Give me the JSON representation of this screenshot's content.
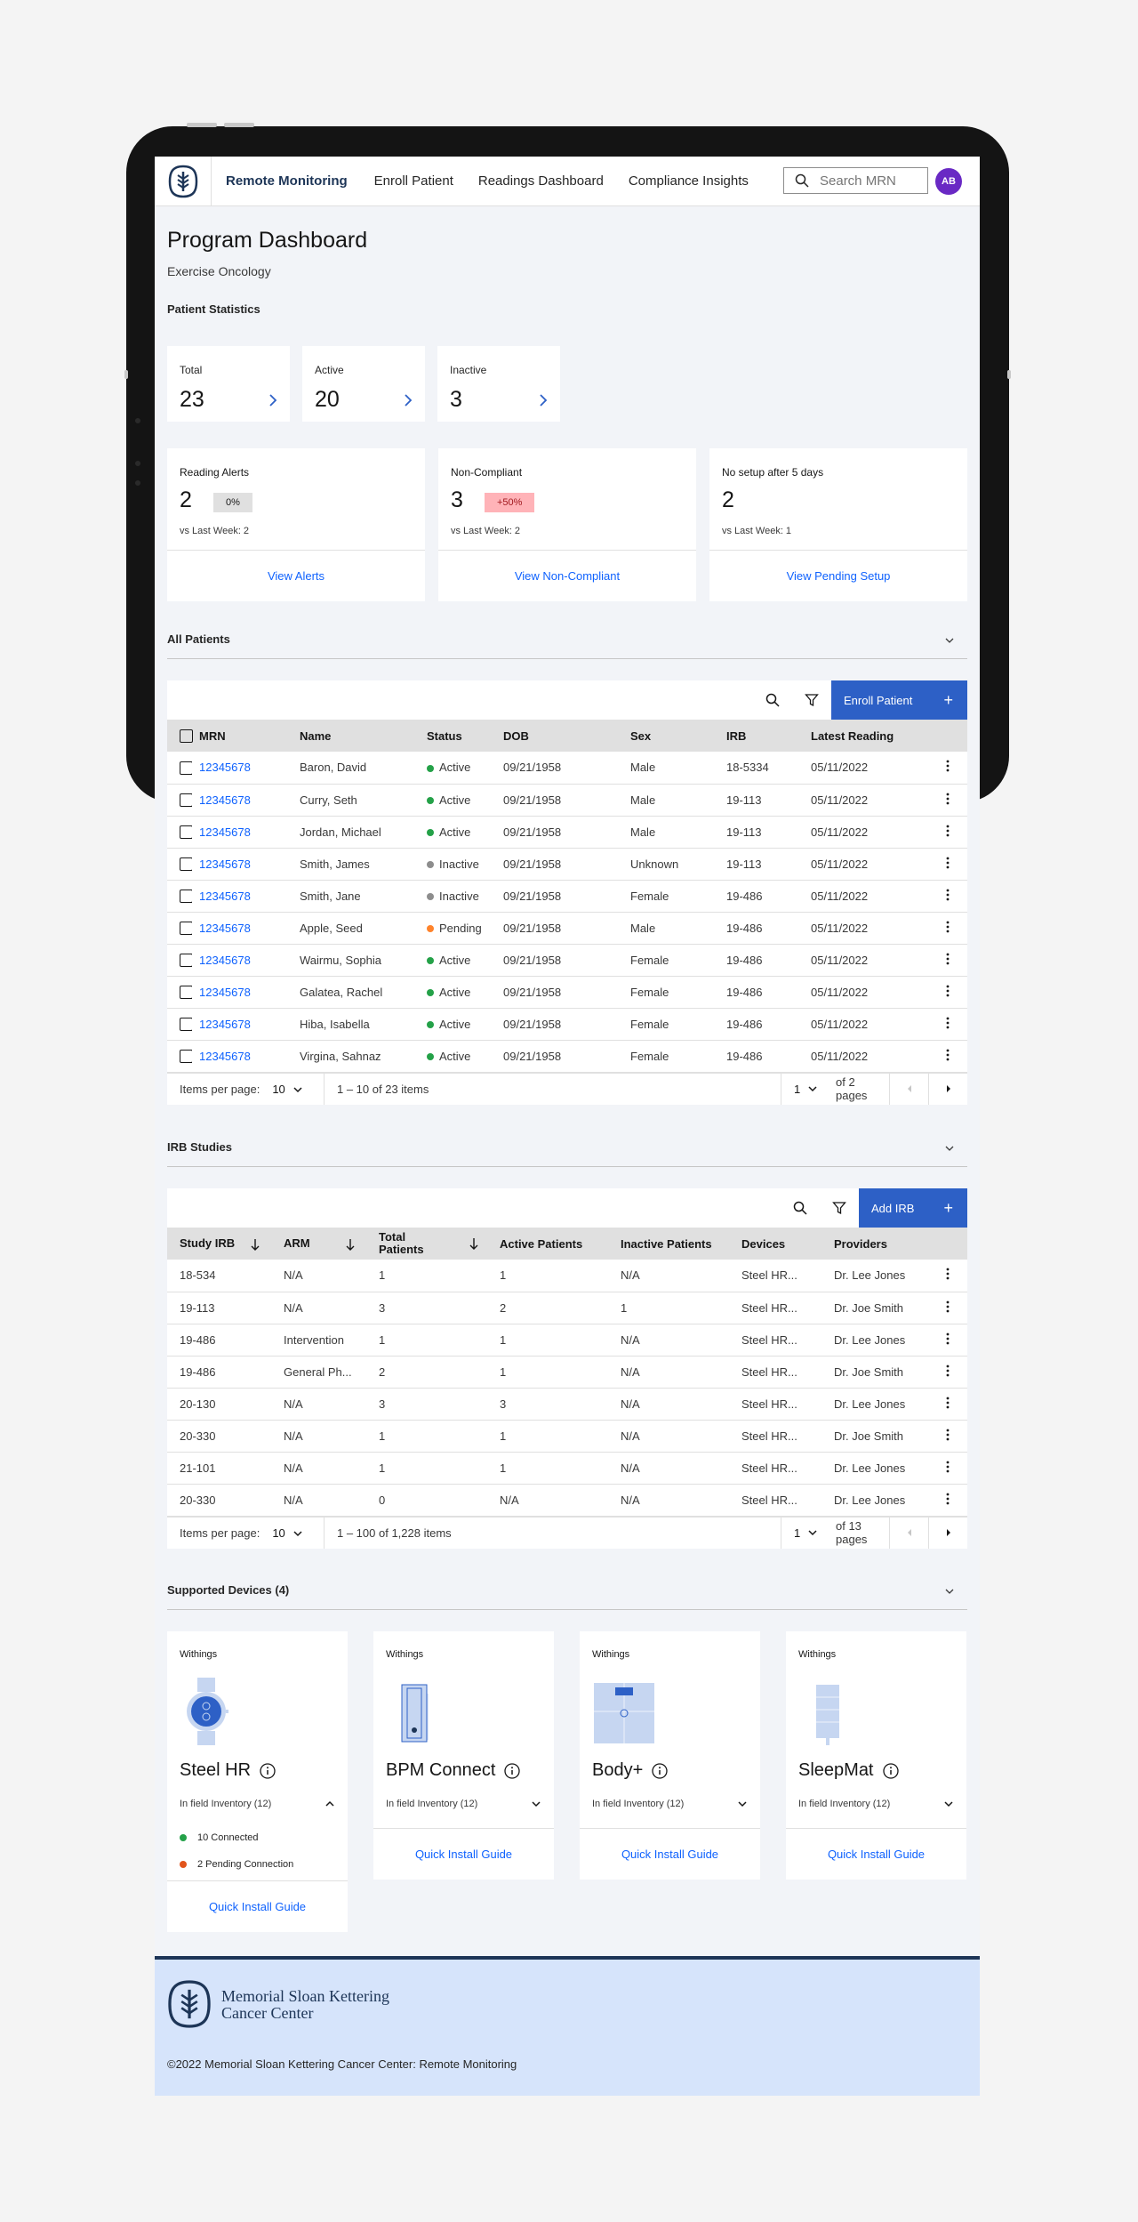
{
  "header": {
    "brand": "Remote Monitoring",
    "nav": [
      "Enroll Patient",
      "Readings Dashboard",
      "Compliance Insights"
    ],
    "search_placeholder": "Search MRN",
    "avatar_initials": "AB"
  },
  "page": {
    "title": "Program Dashboard",
    "subtitle": "Exercise Oncology",
    "stats_label": "Patient Statistics"
  },
  "stats": [
    {
      "label": "Total",
      "value": "23"
    },
    {
      "label": "Active",
      "value": "20"
    },
    {
      "label": "Inactive",
      "value": "3"
    }
  ],
  "alerts": [
    {
      "label": "Reading Alerts",
      "value": "2",
      "badge": "0%",
      "vs": "vs Last Week: 2",
      "link": "View Alerts",
      "badge_color": "#e0e0e0"
    },
    {
      "label": "Non-Compliant",
      "value": "3",
      "badge": "+50%",
      "vs": "vs Last Week: 2",
      "link": "View Non-Compliant",
      "badge_color": "#ffb3b8"
    },
    {
      "label": "No setup after 5 days",
      "value": "2",
      "badge": "",
      "vs": "vs Last Week: 1",
      "link": "View Pending Setup"
    }
  ],
  "patients": {
    "section_title": "All Patients",
    "enroll_label": "Enroll Patient",
    "columns": [
      "MRN",
      "Name",
      "Status",
      "DOB",
      "Sex",
      "IRB",
      "Latest Reading"
    ],
    "rows": [
      {
        "mrn": "12345678",
        "name": "Baron, David",
        "status": "Active",
        "dob": "09/21/1958",
        "sex": "Male",
        "irb": "18-5334",
        "latest": "05/11/2022"
      },
      {
        "mrn": "12345678",
        "name": "Curry, Seth",
        "status": "Active",
        "dob": "09/21/1958",
        "sex": "Male",
        "irb": "19-113",
        "latest": "05/11/2022"
      },
      {
        "mrn": "12345678",
        "name": "Jordan, Michael",
        "status": "Active",
        "dob": "09/21/1958",
        "sex": "Male",
        "irb": "19-113",
        "latest": "05/11/2022"
      },
      {
        "mrn": "12345678",
        "name": "Smith, James",
        "status": "Inactive",
        "dob": "09/21/1958",
        "sex": "Unknown",
        "irb": "19-113",
        "latest": "05/11/2022"
      },
      {
        "mrn": "12345678",
        "name": "Smith, Jane",
        "status": "Inactive",
        "dob": "09/21/1958",
        "sex": "Female",
        "irb": "19-486",
        "latest": "05/11/2022"
      },
      {
        "mrn": "12345678",
        "name": "Apple, Seed",
        "status": "Pending",
        "dob": "09/21/1958",
        "sex": "Male",
        "irb": "19-486",
        "latest": "05/11/2022"
      },
      {
        "mrn": "12345678",
        "name": "Wairmu, Sophia",
        "status": "Active",
        "dob": "09/21/1958",
        "sex": "Female",
        "irb": "19-486",
        "latest": "05/11/2022"
      },
      {
        "mrn": "12345678",
        "name": "Galatea, Rachel",
        "status": "Active",
        "dob": "09/21/1958",
        "sex": "Female",
        "irb": "19-486",
        "latest": "05/11/2022"
      },
      {
        "mrn": "12345678",
        "name": "Hiba, Isabella",
        "status": "Active",
        "dob": "09/21/1958",
        "sex": "Female",
        "irb": "19-486",
        "latest": "05/11/2022"
      },
      {
        "mrn": "12345678",
        "name": "Virgina, Sahnaz",
        "status": "Active",
        "dob": "09/21/1958",
        "sex": "Female",
        "irb": "19-486",
        "latest": "05/11/2022"
      }
    ],
    "pager": {
      "items_label": "Items per page:",
      "per_page": "10",
      "range": "1 – 10 of 23 items",
      "page": "1",
      "of_pages": "of 2 pages"
    }
  },
  "status_colors": {
    "Active": "#24a148",
    "Inactive": "#8d8d8d",
    "Pending": "#ff832b"
  },
  "irb": {
    "section_title": "IRB Studies",
    "add_label": "Add IRB",
    "columns": [
      "Study IRB",
      "ARM",
      "Total Patients",
      "Active Patients",
      "Inactive Patients",
      "Devices",
      "Providers"
    ],
    "rows": [
      {
        "study": "18-534",
        "arm": "N/A",
        "total": "1",
        "active": "1",
        "inactive": "N/A",
        "devices": "Steel HR...",
        "providers": "Dr. Lee Jones"
      },
      {
        "study": "19-113",
        "arm": "N/A",
        "total": "3",
        "active": "2",
        "inactive": "1",
        "devices": "Steel HR...",
        "providers": "Dr. Joe Smith"
      },
      {
        "study": "19-486",
        "arm": "Intervention",
        "total": "1",
        "active": "1",
        "inactive": "N/A",
        "devices": "Steel HR...",
        "providers": "Dr. Lee Jones"
      },
      {
        "study": "19-486",
        "arm": "General Ph...",
        "total": "2",
        "active": "1",
        "inactive": "N/A",
        "devices": "Steel HR...",
        "providers": "Dr. Joe Smith"
      },
      {
        "study": "20-130",
        "arm": "N/A",
        "total": "3",
        "active": "3",
        "inactive": "N/A",
        "devices": "Steel HR...",
        "providers": "Dr. Lee Jones"
      },
      {
        "study": "20-330",
        "arm": "N/A",
        "total": "1",
        "active": "1",
        "inactive": "N/A",
        "devices": "Steel HR...",
        "providers": "Dr. Joe Smith"
      },
      {
        "study": "21-101",
        "arm": "N/A",
        "total": "1",
        "active": "1",
        "inactive": "N/A",
        "devices": "Steel HR...",
        "providers": "Dr. Lee Jones"
      },
      {
        "study": "20-330",
        "arm": "N/A",
        "total": "0",
        "active": "N/A",
        "inactive": "N/A",
        "devices": "Steel HR...",
        "providers": "Dr. Lee Jones"
      }
    ],
    "pager": {
      "items_label": "Items per page:",
      "per_page": "10",
      "range": "1 – 100 of 1,228 items",
      "page": "1",
      "of_pages": "of 13 pages"
    }
  },
  "devices": {
    "section_title": "Supported Devices (4)",
    "items": [
      {
        "brand": "Withings",
        "name": "Steel HR",
        "inventory": "In field Inventory (12)",
        "connected": "10 Connected",
        "pending": "2 Pending Connection",
        "guide": "Quick Install Guide"
      },
      {
        "brand": "Withings",
        "name": "BPM Connect",
        "inventory": "In field Inventory (12)",
        "guide": "Quick Install Guide"
      },
      {
        "brand": "Withings",
        "name": "Body+",
        "inventory": "In field Inventory (12)",
        "guide": "Quick Install Guide"
      },
      {
        "brand": "Withings",
        "name": "SleepMat",
        "inventory": "In field Inventory (12)",
        "guide": "Quick Install Guide"
      }
    ]
  },
  "footer": {
    "logo_line1": "Memorial Sloan Kettering",
    "logo_line2": "Cancer Center",
    "copyright": "©2022 Memorial Sloan Kettering Cancer Center: Remote Monitoring"
  },
  "colors": {
    "accent": "#2d60c6",
    "link": "#0f62fe",
    "brand_navy": "#1d3557",
    "avatar": "#6929c4"
  }
}
